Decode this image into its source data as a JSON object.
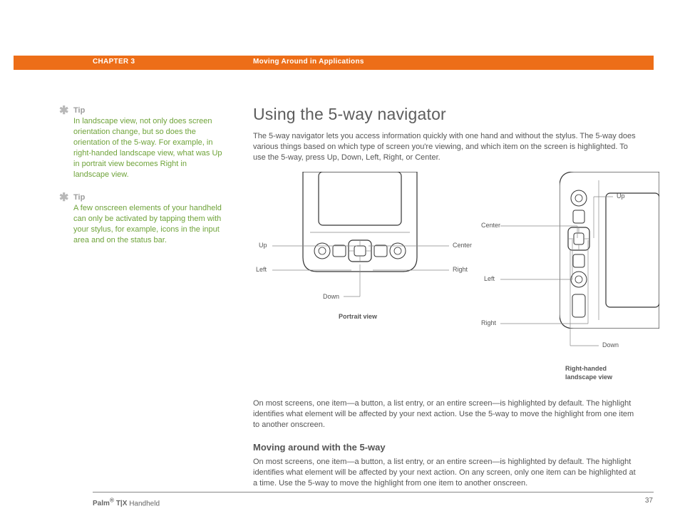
{
  "header": {
    "chapter": "CHAPTER 3",
    "section": "Moving Around in Applications"
  },
  "sidebar": {
    "tip1_head": "Tip",
    "tip1_body": "In landscape view, not only does screen orientation change, but so does the orientation of the 5-way. For example, in right-handed landscape view, what was Up in portrait view becomes Right in landscape view.",
    "tip2_head": "Tip",
    "tip2_body": "A few onscreen elements of your handheld can only be activated by tapping them with your stylus, for example, icons in the input area and on the status bar."
  },
  "main": {
    "h1": "Using the 5-way navigator",
    "intro": "The 5-way navigator lets you access information quickly with one hand and without the stylus. The 5-way does various things based on which type of screen you're viewing, and which item on the screen is highlighted. To use the 5-way, press Up, Down, Left, Right, or Center.",
    "para2": "On most screens, one item—a button, a list entry, or an entire screen—is highlighted by default. The highlight identifies what element will be affected by your next action. Use the 5-way to move the highlight from one item to another onscreen.",
    "h2": "Moving around with the 5-way",
    "para3": "On most screens, one item—a button, a list entry, or an entire screen—is highlighted by default. The highlight identifies what element will be affected by your next action. On any screen, only one item can be highlighted at a time. Use the 5-way to move the highlight from one item to another onscreen."
  },
  "diagram": {
    "up": "Up",
    "down": "Down",
    "left": "Left",
    "right": "Right",
    "center": "Center",
    "caption_portrait": "Portrait view",
    "caption_landscape": "Right-handed landscape view"
  },
  "footer": {
    "brand": "Palm",
    "model": "T|X",
    "product": "Handheld",
    "page": "37"
  }
}
